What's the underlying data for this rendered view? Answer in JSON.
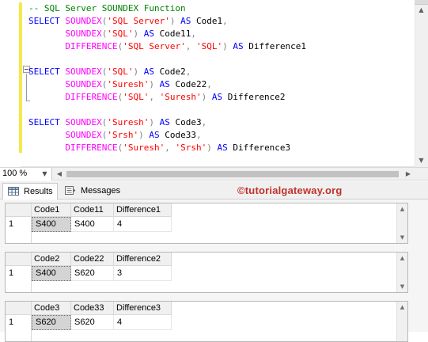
{
  "editor": {
    "lines": [
      [
        {
          "c": "cm",
          "t": "-- SQL Server SOUNDEX Function"
        }
      ],
      [
        {
          "c": "kw",
          "t": "SELECT "
        },
        {
          "c": "fn",
          "t": "SOUNDEX"
        },
        {
          "c": "gy",
          "t": "("
        },
        {
          "c": "st",
          "t": "'SQL Server'"
        },
        {
          "c": "gy",
          "t": ")"
        },
        {
          "c": "kw",
          "t": " AS "
        },
        {
          "c": "bk",
          "t": "Code1"
        },
        {
          "c": "gy",
          "t": ","
        }
      ],
      [
        {
          "c": "bk",
          "t": "       "
        },
        {
          "c": "fn",
          "t": "SOUNDEX"
        },
        {
          "c": "gy",
          "t": "("
        },
        {
          "c": "st",
          "t": "'SQL'"
        },
        {
          "c": "gy",
          "t": ")"
        },
        {
          "c": "kw",
          "t": " AS "
        },
        {
          "c": "bk",
          "t": "Code11"
        },
        {
          "c": "gy",
          "t": ","
        }
      ],
      [
        {
          "c": "bk",
          "t": "       "
        },
        {
          "c": "fn",
          "t": "DIFFERENCE"
        },
        {
          "c": "gy",
          "t": "("
        },
        {
          "c": "st",
          "t": "'SQL Server'"
        },
        {
          "c": "gy",
          "t": ", "
        },
        {
          "c": "st",
          "t": "'SQL'"
        },
        {
          "c": "gy",
          "t": ")"
        },
        {
          "c": "kw",
          "t": " AS "
        },
        {
          "c": "bk",
          "t": "Difference1"
        }
      ],
      [],
      [
        {
          "c": "kw",
          "t": "SELECT "
        },
        {
          "c": "fn",
          "t": "SOUNDEX"
        },
        {
          "c": "gy",
          "t": "("
        },
        {
          "c": "st",
          "t": "'SQL'"
        },
        {
          "c": "gy",
          "t": ")"
        },
        {
          "c": "kw",
          "t": " AS "
        },
        {
          "c": "bk",
          "t": "Code2"
        },
        {
          "c": "gy",
          "t": ","
        }
      ],
      [
        {
          "c": "bk",
          "t": "       "
        },
        {
          "c": "fn",
          "t": "SOUNDEX"
        },
        {
          "c": "gy",
          "t": "("
        },
        {
          "c": "st",
          "t": "'Suresh'"
        },
        {
          "c": "gy",
          "t": ")"
        },
        {
          "c": "kw",
          "t": " AS "
        },
        {
          "c": "bk",
          "t": "Code22"
        },
        {
          "c": "gy",
          "t": ","
        }
      ],
      [
        {
          "c": "bk",
          "t": "       "
        },
        {
          "c": "fn",
          "t": "DIFFERENCE"
        },
        {
          "c": "gy",
          "t": "("
        },
        {
          "c": "st",
          "t": "'SQL'"
        },
        {
          "c": "gy",
          "t": ", "
        },
        {
          "c": "st",
          "t": "'Suresh'"
        },
        {
          "c": "gy",
          "t": ")"
        },
        {
          "c": "kw",
          "t": " AS "
        },
        {
          "c": "bk",
          "t": "Difference2"
        }
      ],
      [],
      [
        {
          "c": "kw",
          "t": "SELECT "
        },
        {
          "c": "fn",
          "t": "SOUNDEX"
        },
        {
          "c": "gy",
          "t": "("
        },
        {
          "c": "st",
          "t": "'Suresh'"
        },
        {
          "c": "gy",
          "t": ")"
        },
        {
          "c": "kw",
          "t": " AS "
        },
        {
          "c": "bk",
          "t": "Code3"
        },
        {
          "c": "gy",
          "t": ","
        }
      ],
      [
        {
          "c": "bk",
          "t": "       "
        },
        {
          "c": "fn",
          "t": "SOUNDEX"
        },
        {
          "c": "gy",
          "t": "("
        },
        {
          "c": "st",
          "t": "'Srsh'"
        },
        {
          "c": "gy",
          "t": ")"
        },
        {
          "c": "kw",
          "t": " AS "
        },
        {
          "c": "bk",
          "t": "Code33"
        },
        {
          "c": "gy",
          "t": ","
        }
      ],
      [
        {
          "c": "bk",
          "t": "       "
        },
        {
          "c": "fn",
          "t": "DIFFERENCE"
        },
        {
          "c": "gy",
          "t": "("
        },
        {
          "c": "st",
          "t": "'Suresh'"
        },
        {
          "c": "gy",
          "t": ", "
        },
        {
          "c": "st",
          "t": "'Srsh'"
        },
        {
          "c": "gy",
          "t": ")"
        },
        {
          "c": "kw",
          "t": " AS "
        },
        {
          "c": "bk",
          "t": "Difference3"
        }
      ]
    ]
  },
  "zoom": {
    "value": "100 %"
  },
  "tabs": {
    "results": "Results",
    "messages": "Messages"
  },
  "brand": "©tutorialgateway.org",
  "grids": [
    {
      "headers": [
        "Code1",
        "Code11",
        "Difference1"
      ],
      "row_number": "1",
      "cells": [
        "S400",
        "S400",
        "4"
      ]
    },
    {
      "headers": [
        "Code2",
        "Code22",
        "Difference2"
      ],
      "row_number": "1",
      "cells": [
        "S400",
        "S620",
        "3"
      ]
    },
    {
      "headers": [
        "Code3",
        "Code33",
        "Difference3"
      ],
      "row_number": "1",
      "cells": [
        "S620",
        "S620",
        "4"
      ]
    }
  ],
  "colors": {
    "keyword": "#0000ff",
    "function": "#ff00ff",
    "string": "#ff0000",
    "comment": "#008000",
    "brand": "#c0312b"
  }
}
